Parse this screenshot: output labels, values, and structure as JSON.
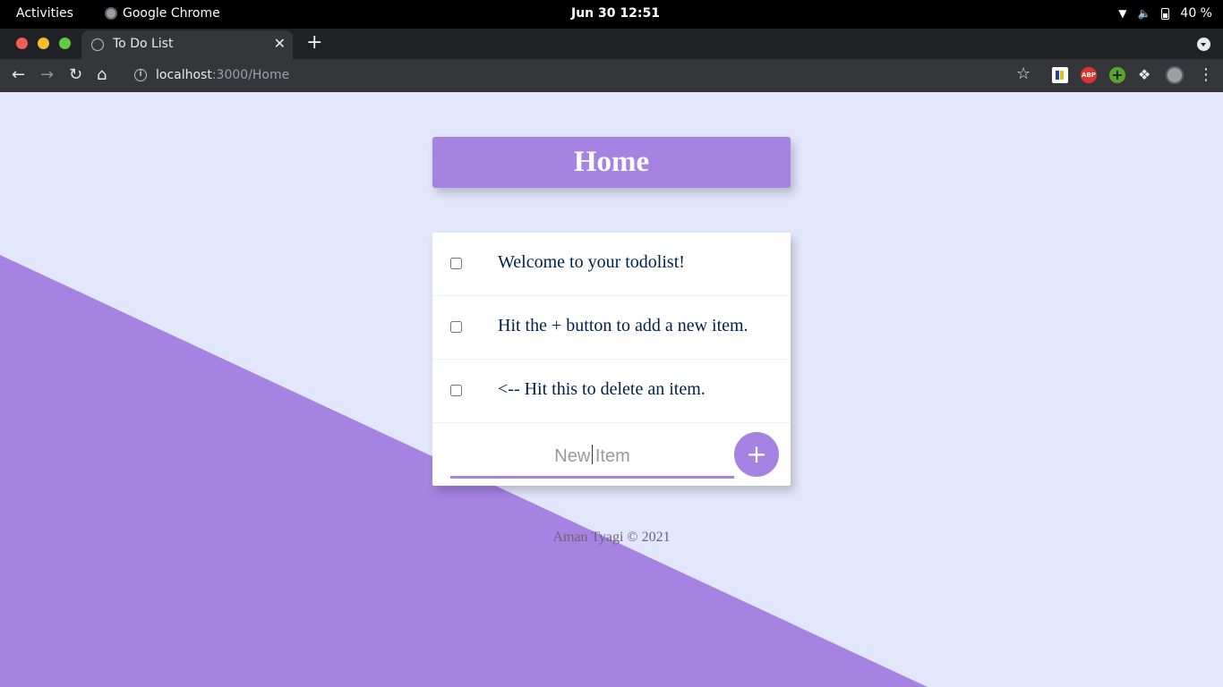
{
  "system_bar": {
    "activities": "Activities",
    "app_name": "Google Chrome",
    "clock": "Jun 30  12:51",
    "battery": "40 %"
  },
  "browser": {
    "tab_title": "To Do List",
    "url_host": "localhost",
    "url_path": ":3000/Home",
    "extensions": [
      "flag-extension",
      "adblock-plus",
      "green-plus-extension",
      "extensions-puzzle",
      "profile-avatar"
    ]
  },
  "page": {
    "heading": "Home",
    "items": [
      {
        "text": "Welcome to your todolist!",
        "checked": false
      },
      {
        "text": "Hit the + button to add a new item.",
        "checked": false
      },
      {
        "text": "<-- Hit this to delete an item.",
        "checked": false
      }
    ],
    "new_item_placeholder": "New Item",
    "add_button_label": "+",
    "footer": "Aman Tyagi © 2021",
    "colors": {
      "accent": "#a683e3",
      "background": "#e3e7fb",
      "item_text": "#00204a"
    }
  }
}
